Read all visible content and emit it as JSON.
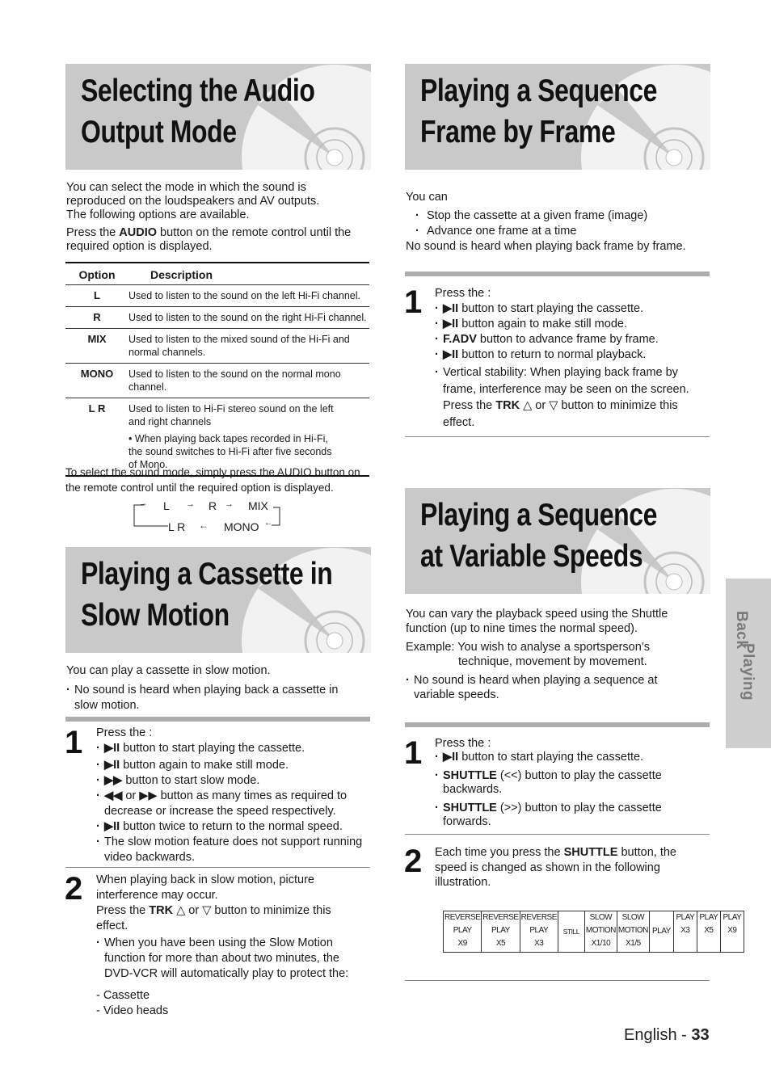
{
  "sections": {
    "audio": {
      "title_line1": "Selecting the Audio",
      "title_line2": "Output Mode",
      "intro1": "You can select the mode in which the sound is",
      "intro2": "reproduced on the loudspeakers and AV outputs.",
      "intro3": "The following options are available.",
      "press_pre": "Press the ",
      "press_bold": "AUDIO",
      "press_post": " button on the remote control until the",
      "press_line2": "required option is displayed.",
      "table": {
        "headers": [
          "Option",
          "Description"
        ],
        "rows": [
          {
            "option": "L",
            "desc": "Used to listen to the sound on the left Hi-Fi channel."
          },
          {
            "option": "R",
            "desc": "Used to listen to the sound on the right Hi-Fi channel."
          },
          {
            "option": "MIX",
            "desc": "Used to listen to the mixed sound of the Hi-Fi and normal channels."
          },
          {
            "option": "MONO",
            "desc": "Used to listen to the sound on the normal mono channel."
          },
          {
            "option": "L R",
            "desc": "Used to listen to Hi-Fi stereo sound on the left and right channels",
            "note": "• When playing back tapes recorded in Hi-Fi, the sound switches to Hi-Fi after five seconds of Mono."
          }
        ]
      },
      "select_note1": "To select the sound mode, simply press the AUDIO button on",
      "select_note2": "the remote control until the required option is displayed.",
      "cycle": {
        "l": "L",
        "r": "R",
        "mix": "MIX",
        "lr": "L R",
        "mono": "MONO",
        "arrow_right": "→",
        "arrow_left": "←"
      }
    },
    "slow": {
      "title_line1": "Playing a Cassette in",
      "title_line2": "Slow Motion",
      "intro": "You can play a cassette in slow motion.",
      "note": "No sound is heard when playing back a cassette in slow motion.",
      "step1": {
        "num": "1",
        "lead": "Press the :",
        "items": [
          {
            "sym": "▶II",
            "text": " button to start playing the cassette."
          },
          {
            "sym": "▶II",
            "text": " button again to make still mode."
          },
          {
            "sym": "▶▶",
            "text": " button to start slow mode."
          },
          {
            "sym": "◀◀",
            "text": " or ▶▶ button as many times as required to decrease or increase the speed respectively."
          },
          {
            "sym": "▶II",
            "text": " button twice to return to the normal speed."
          },
          {
            "sym": "",
            "text": "The slow motion feature does not support running video backwards."
          }
        ]
      },
      "step2": {
        "num": "2",
        "line1": "When playing back in slow motion, picture interference may occur.",
        "press_pre": "Press the ",
        "press_bold": "TRK",
        "press_post": " △ or ▽ button to minimize this effect.",
        "bullet": "When you have been using the Slow Motion function for more than about two minutes, the DVD-VCR will automatically play to protect the:",
        "dash1": "- Cassette",
        "dash2": "- Video heads"
      }
    },
    "frame": {
      "title_line1": "Playing a Sequence",
      "title_line2": "Frame by Frame",
      "intro": "You can",
      "bullets": [
        "Stop the cassette at a given frame (image)",
        "Advance one frame at a time"
      ],
      "note": "No sound is heard when playing back frame by frame.",
      "step1": {
        "num": "1",
        "lead": "Press the :",
        "items": [
          {
            "sym": "▶II",
            "text": " button to start playing the cassette."
          },
          {
            "sym": "▶II",
            "text": " button again to make still mode."
          },
          {
            "sym": "F.ADV",
            "text": " button to advance frame by frame."
          },
          {
            "sym": "▶II",
            "text": " button to return to normal playback."
          }
        ],
        "vert_pre": "Vertical stability: When playing back frame by frame, interference may be seen on the screen. Press the ",
        "vert_bold": "TRK",
        "vert_post": " △ or ▽ button to minimize this effect."
      }
    },
    "variable": {
      "title_line1": "Playing a Sequence",
      "title_line2": "at Variable Speeds",
      "intro": "You can vary the playback speed using the Shuttle function (up to nine times the normal speed).",
      "example_label": "Example: You wish to analyse a sportsperson’s",
      "example_cont": "technique, movement by movement.",
      "note": "No sound is heard when playing a sequence at variable speeds.",
      "step1": {
        "num": "1",
        "lead": "Press the :",
        "items": [
          {
            "sym": "▶II",
            "text": " button to start playing the cassette."
          },
          {
            "sym": "SHUTTLE",
            "text": " (<<) button to play the cassette backwards."
          },
          {
            "sym": "SHUTTLE",
            "text": " (>>) button to play the cassette forwards."
          }
        ]
      },
      "step2": {
        "num": "2",
        "pre": "Each time you press the ",
        "bold": "SHUTTLE",
        "post": " button, the speed is changed as shown in the following illustration."
      },
      "speeds": [
        [
          "REVERSE",
          "PLAY",
          "X9"
        ],
        [
          "REVERSE",
          "PLAY",
          "X5"
        ],
        [
          "REVERSE",
          "PLAY",
          "X3"
        ],
        [
          "",
          "STILL",
          ""
        ],
        [
          "SLOW",
          "MOTION",
          "X1/10"
        ],
        [
          "SLOW",
          "MOTION",
          "X1/5"
        ],
        [
          "",
          "PLAY",
          ""
        ],
        [
          "PLAY",
          "X3",
          ""
        ],
        [
          "PLAY",
          "X5",
          ""
        ],
        [
          "PLAY",
          "X9",
          ""
        ]
      ]
    }
  },
  "side_tab": {
    "word1": "Playing",
    "word2": "Back"
  },
  "footer": {
    "lang": "English - ",
    "page": "33"
  }
}
